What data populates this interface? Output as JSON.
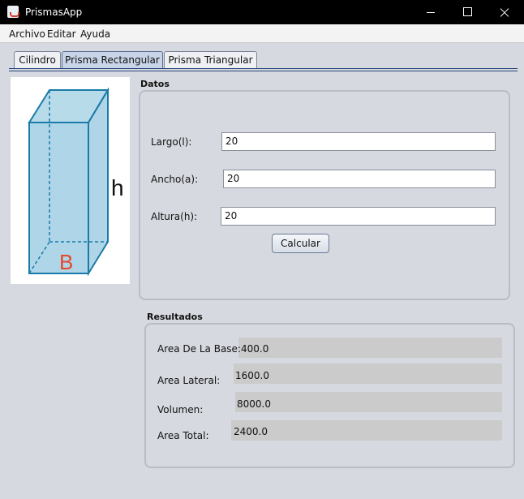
{
  "window": {
    "title": "PrismasApp"
  },
  "menu": {
    "items": [
      "Archivo",
      "Editar",
      "Ayuda"
    ]
  },
  "tabs": [
    {
      "label": "Cilindro",
      "selected": false
    },
    {
      "label": "Prisma Rectangular",
      "selected": true
    },
    {
      "label": "Prisma Triangular",
      "selected": false
    }
  ],
  "image": {
    "height_label": "h",
    "base_label": "B"
  },
  "datos": {
    "title": "Datos",
    "largo": {
      "label": "Largo(l):",
      "value": "20"
    },
    "ancho": {
      "label": "Ancho(a):",
      "value": "20"
    },
    "altura": {
      "label": "Altura(h):",
      "value": "20"
    },
    "button": "Calcular"
  },
  "resultados": {
    "title": "Resultados",
    "area_base": {
      "label": "Area De La Base:",
      "value": "400.0"
    },
    "area_lateral": {
      "label": "Area Lateral:",
      "value": "1600.0"
    },
    "volumen": {
      "label": "Volumen:",
      "value": "8000.0"
    },
    "area_total": {
      "label": "Area Total:",
      "value": "2400.0"
    }
  },
  "colors": {
    "window_bg": "#d6d9df",
    "titlebar": "#000000",
    "accent_line": "#27447a",
    "prism_fill": "#6db5d6",
    "prism_stroke": "#1a7aa8",
    "base_label": "#e8472a"
  }
}
